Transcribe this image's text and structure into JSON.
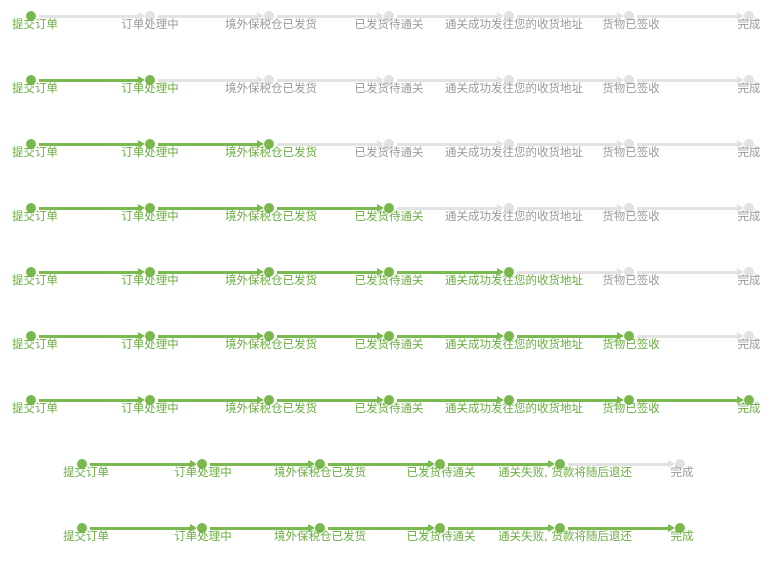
{
  "colors": {
    "active": "#7ab94d",
    "active_text": "#6aae3f",
    "inactive": "#e2e2e2",
    "inactive_text": "#9a9a9a"
  },
  "trackers": [
    {
      "steps": [
        "提交订单",
        "订单处理中",
        "境外保税仓已发货",
        "已发货待通关",
        "通关成功发往您的收货地址",
        "货物已签收",
        "完成"
      ],
      "completed": 1
    },
    {
      "steps": [
        "提交订单",
        "订单处理中",
        "境外保税仓已发货",
        "已发货待通关",
        "通关成功发往您的收货地址",
        "货物已签收",
        "完成"
      ],
      "completed": 2
    },
    {
      "steps": [
        "提交订单",
        "订单处理中",
        "境外保税仓已发货",
        "已发货待通关",
        "通关成功发往您的收货地址",
        "货物已签收",
        "完成"
      ],
      "completed": 3
    },
    {
      "steps": [
        "提交订单",
        "订单处理中",
        "境外保税仓已发货",
        "已发货待通关",
        "通关成功发往您的收货地址",
        "货物已签收",
        "完成"
      ],
      "completed": 4
    },
    {
      "steps": [
        "提交订单",
        "订单处理中",
        "境外保税仓已发货",
        "已发货待通关",
        "通关成功发往您的收货地址",
        "货物已签收",
        "完成"
      ],
      "completed": 5
    },
    {
      "steps": [
        "提交订单",
        "订单处理中",
        "境外保税仓已发货",
        "已发货待通关",
        "通关成功发往您的收货地址",
        "货物已签收",
        "完成"
      ],
      "completed": 6
    },
    {
      "steps": [
        "提交订单",
        "订单处理中",
        "境外保税仓已发货",
        "已发货待通关",
        "通关成功发往您的收货地址",
        "货物已签收",
        "完成"
      ],
      "completed": 7
    },
    {
      "steps": [
        "提交订单",
        "订单处理中",
        "境外保税仓已发货",
        "已发货待通关",
        "通关失败, 货款将随后退还",
        "完成"
      ],
      "completed": 5
    },
    {
      "steps": [
        "提交订单",
        "订单处理中",
        "境外保税仓已发货",
        "已发货待通关",
        "通关失败, 货款将随后退还",
        "完成"
      ],
      "completed": 6
    }
  ]
}
